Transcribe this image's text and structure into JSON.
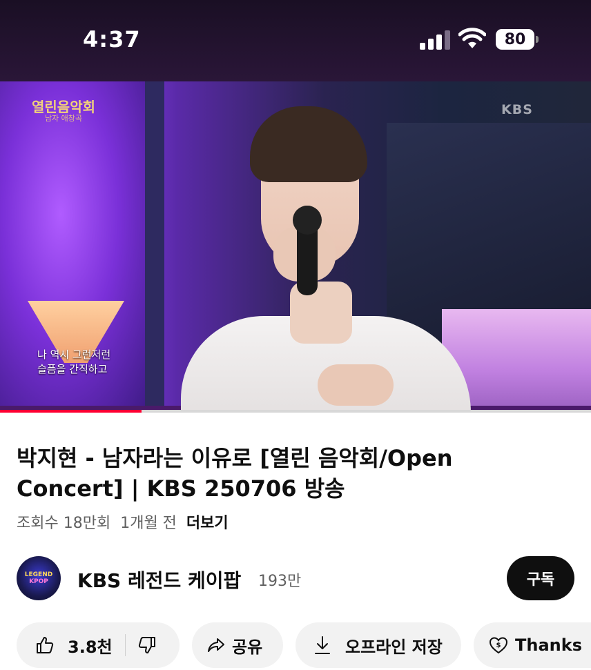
{
  "status_bar": {
    "time": "4:37",
    "battery": "80",
    "icons": [
      "cellular-signal-icon",
      "wifi-icon",
      "battery-icon"
    ]
  },
  "video": {
    "logo_line1": "열린음악회",
    "logo_line2": "남자 애창곡",
    "broadcaster": "KBS",
    "caption_line1": "나 역시 그런저런",
    "caption_line2": "슬픔을 간직하고",
    "progress": 0.24,
    "progress_color": "#ff0033"
  },
  "info": {
    "title": "박지현 - 남자라는 이유로 [열린 음악회/Open Concert] | KBS 250706 방송",
    "views": "조회수 18만회",
    "age": "1개월 전",
    "more": "더보기"
  },
  "channel": {
    "avatar_line1": "LEGEND",
    "avatar_line2": "KPOP",
    "name": "KBS 레전드 케이팝",
    "subscribers": "193만",
    "subscribe_label": "구독"
  },
  "actions": {
    "likes": "3.8천",
    "share_label": "공유",
    "offline_label": "오프라인 저장",
    "thanks_label": "Thanks",
    "icons": [
      "thumbs-up-icon",
      "thumbs-down-icon",
      "share-arrow-icon",
      "download-icon",
      "thanks-heart-icon"
    ]
  }
}
